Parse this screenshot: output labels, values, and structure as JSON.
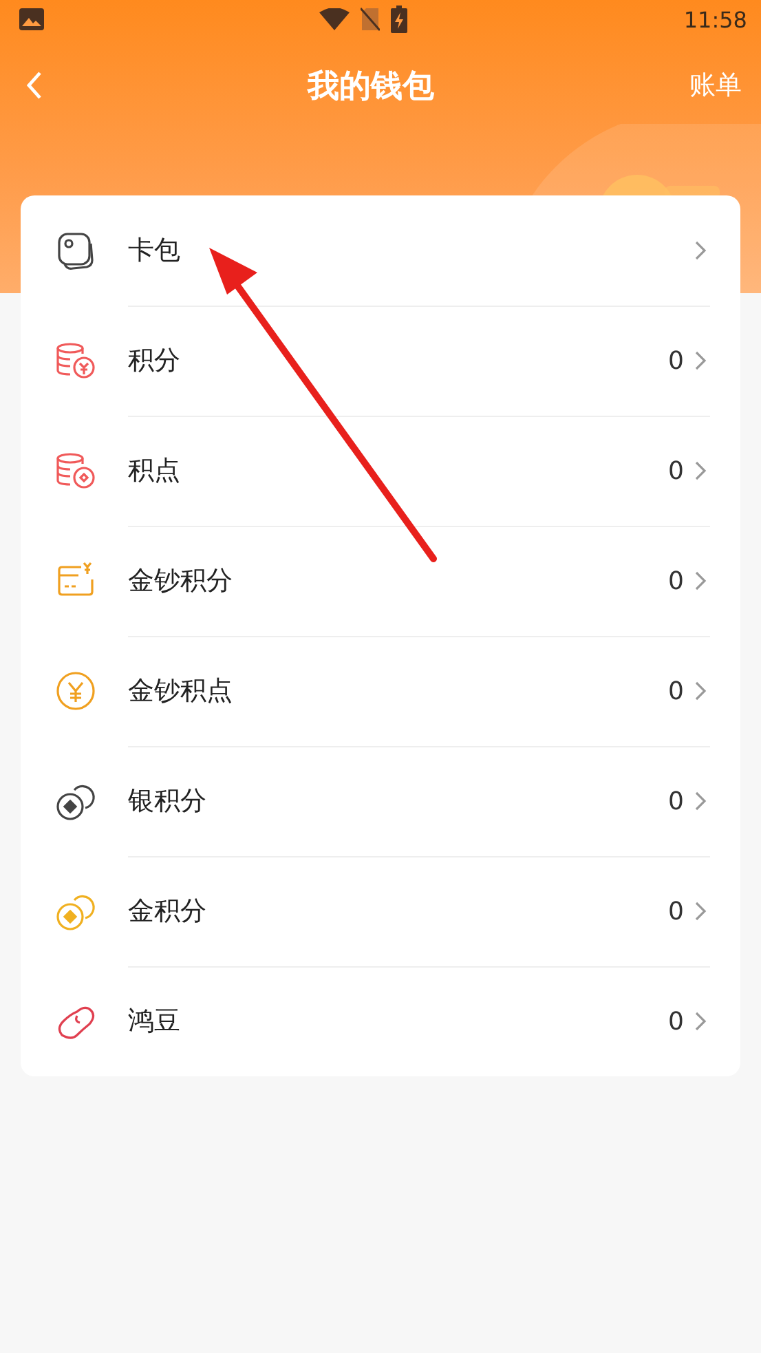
{
  "status_bar": {
    "time": "11:58"
  },
  "header": {
    "title": "我的钱包",
    "action": "账单"
  },
  "items": [
    {
      "kind": "cards",
      "label": "卡包"
    },
    {
      "kind": "coins-yen",
      "label": "积分",
      "value": "0"
    },
    {
      "kind": "coins-dot",
      "label": "积点",
      "value": "0"
    },
    {
      "kind": "card-yen",
      "label": "金钞积分",
      "value": "0"
    },
    {
      "kind": "yen-circle",
      "label": "金钞积点",
      "value": "0"
    },
    {
      "kind": "silver-coins",
      "label": "银积分",
      "value": "0"
    },
    {
      "kind": "gold-coins",
      "label": "金积分",
      "value": "0"
    },
    {
      "kind": "bean",
      "label": "鸿豆",
      "value": "0"
    }
  ]
}
